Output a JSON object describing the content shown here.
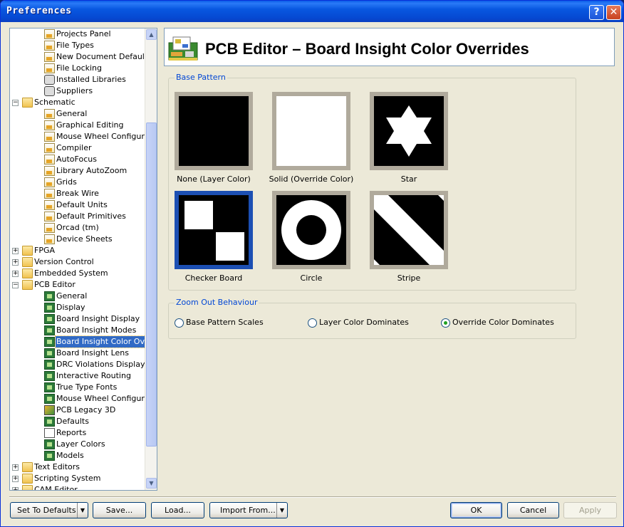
{
  "window": {
    "title": "Preferences",
    "help_glyph": "?",
    "close_glyph": "✕"
  },
  "tree": {
    "items": [
      {
        "label": "Projects Panel",
        "level": 2,
        "icon": "page-icon"
      },
      {
        "label": "File Types",
        "level": 2,
        "icon": "page-icon"
      },
      {
        "label": "New Document Defaults",
        "level": 2,
        "icon": "page-icon"
      },
      {
        "label": "File Locking",
        "level": 2,
        "icon": "page-icon"
      },
      {
        "label": "Installed Libraries",
        "level": 2,
        "icon": "library-icon"
      },
      {
        "label": "Suppliers",
        "level": 2,
        "icon": "library-icon"
      },
      {
        "label": "Schematic",
        "level": 1,
        "icon": "folder-icon",
        "expander": "−"
      },
      {
        "label": "General",
        "level": 2,
        "icon": "page-icon"
      },
      {
        "label": "Graphical Editing",
        "level": 2,
        "icon": "page-icon"
      },
      {
        "label": "Mouse Wheel Configuration",
        "level": 2,
        "icon": "page-icon"
      },
      {
        "label": "Compiler",
        "level": 2,
        "icon": "page-icon"
      },
      {
        "label": "AutoFocus",
        "level": 2,
        "icon": "page-icon"
      },
      {
        "label": "Library AutoZoom",
        "level": 2,
        "icon": "page-icon"
      },
      {
        "label": "Grids",
        "level": 2,
        "icon": "page-icon"
      },
      {
        "label": "Break Wire",
        "level": 2,
        "icon": "page-icon"
      },
      {
        "label": "Default Units",
        "level": 2,
        "icon": "page-icon"
      },
      {
        "label": "Default Primitives",
        "level": 2,
        "icon": "page-icon"
      },
      {
        "label": "Orcad (tm)",
        "level": 2,
        "icon": "page-icon"
      },
      {
        "label": "Device Sheets",
        "level": 2,
        "icon": "page-icon"
      },
      {
        "label": "FPGA",
        "level": 1,
        "icon": "folder-icon",
        "expander": "+"
      },
      {
        "label": "Version Control",
        "level": 1,
        "icon": "folder-icon",
        "expander": "+"
      },
      {
        "label": "Embedded System",
        "level": 1,
        "icon": "folder-icon",
        "expander": "+"
      },
      {
        "label": "PCB Editor",
        "level": 1,
        "icon": "folder-icon",
        "expander": "−"
      },
      {
        "label": "General",
        "level": 2,
        "icon": "chip-icon"
      },
      {
        "label": "Display",
        "level": 2,
        "icon": "chip-icon"
      },
      {
        "label": "Board Insight Display",
        "level": 2,
        "icon": "chip-icon"
      },
      {
        "label": "Board Insight Modes",
        "level": 2,
        "icon": "chip-icon"
      },
      {
        "label": "Board Insight Color Overrides",
        "level": 2,
        "icon": "chip-icon",
        "selected": true
      },
      {
        "label": "Board Insight Lens",
        "level": 2,
        "icon": "chip-icon"
      },
      {
        "label": "DRC Violations Display",
        "level": 2,
        "icon": "chip-icon"
      },
      {
        "label": "Interactive Routing",
        "level": 2,
        "icon": "chip-icon"
      },
      {
        "label": "True Type Fonts",
        "level": 2,
        "icon": "chip-icon"
      },
      {
        "label": "Mouse Wheel Configuration",
        "level": 2,
        "icon": "chip-icon"
      },
      {
        "label": "PCB Legacy 3D",
        "level": 2,
        "icon": "pcb-3d-icon"
      },
      {
        "label": "Defaults",
        "level": 2,
        "icon": "chip-icon"
      },
      {
        "label": "Reports",
        "level": 2,
        "icon": "document-icon"
      },
      {
        "label": "Layer Colors",
        "level": 2,
        "icon": "chip-icon"
      },
      {
        "label": "Models",
        "level": 2,
        "icon": "chip-icon"
      },
      {
        "label": "Text Editors",
        "level": 1,
        "icon": "folder-icon",
        "expander": "+"
      },
      {
        "label": "Scripting System",
        "level": 1,
        "icon": "folder-icon",
        "expander": "+"
      },
      {
        "label": "CAM Editor",
        "level": 1,
        "icon": "folder-icon",
        "expander": "+"
      }
    ]
  },
  "header": {
    "title": "PCB Editor – Board Insight Color Overrides",
    "icon": "pcb-board-icon"
  },
  "base_pattern": {
    "legend": "Base Pattern",
    "patterns": [
      {
        "label": "None (Layer Color)",
        "icon": "solid-black-swatch",
        "selected": false
      },
      {
        "label": "Solid (Override Color)",
        "icon": "solid-white-swatch",
        "selected": false
      },
      {
        "label": "Star",
        "icon": "star-swatch",
        "selected": false
      },
      {
        "label": "Checker Board",
        "icon": "checker-board-swatch",
        "selected": true
      },
      {
        "label": "Circle",
        "icon": "circle-swatch",
        "selected": false
      },
      {
        "label": "Stripe",
        "icon": "stripe-swatch",
        "selected": false
      }
    ]
  },
  "zoom_out": {
    "legend": "Zoom Out Behaviour",
    "options": [
      {
        "label": "Base Pattern Scales",
        "checked": false
      },
      {
        "label": "Layer Color Dominates",
        "checked": false
      },
      {
        "label": "Override Color Dominates",
        "checked": true
      }
    ]
  },
  "buttons": {
    "set_to_defaults": "Set To Defaults",
    "save": "Save...",
    "load": "Load...",
    "import_from": "Import From...",
    "ok": "OK",
    "cancel": "Cancel",
    "apply": "Apply",
    "dropdown_glyph": "▼"
  },
  "colors": {
    "selection": "#316ac5",
    "selected_pattern_border": "#1c4fb3",
    "legend": "#0046d5",
    "title_bar": "#0a5ce8"
  }
}
